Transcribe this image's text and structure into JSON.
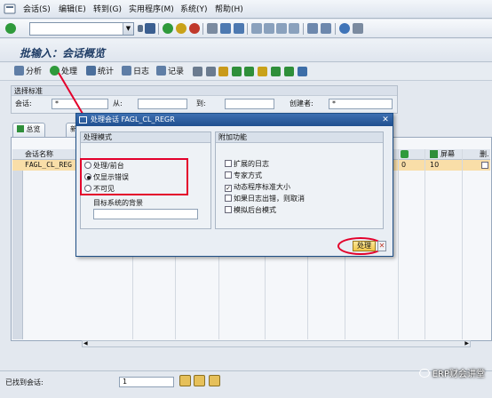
{
  "menubar": {
    "items": [
      {
        "label": "会话(S)"
      },
      {
        "label": "编辑(E)"
      },
      {
        "label": "转到(G)"
      },
      {
        "label": "实用程序(M)"
      },
      {
        "label": "系统(Y)"
      },
      {
        "label": "帮助(H)"
      }
    ]
  },
  "toolbar": {
    "command_field_value": ""
  },
  "page": {
    "title": "批输入：会话概览"
  },
  "app_toolbar": {
    "analyze_label": "分析",
    "process_label": "处理",
    "stats_label": "统计",
    "log_label": "日志",
    "record_label": "记录"
  },
  "selection": {
    "header": "选择标准",
    "session_label": "会话:",
    "session_value": "*",
    "from_label": "从:",
    "to_label": "到:",
    "creator_label": "创建者:",
    "creator_value": "*"
  },
  "tabs": [
    {
      "label": "总览"
    },
    {
      "label": "新"
    }
  ],
  "grid": {
    "col_name": "会话名称",
    "col_screens": "屏幕",
    "col_delete": "删.",
    "row": {
      "name": "FAGL_CL_REG",
      "count": "0",
      "screens": "10"
    }
  },
  "dialog": {
    "title": "处理会话 FAGL_CL_REGR",
    "mode_group": "处理模式",
    "modes": [
      {
        "label": "处理/前台",
        "selected": false
      },
      {
        "label": "仅显示错误",
        "selected": true
      },
      {
        "label": "不可见",
        "selected": false
      }
    ],
    "target_label": "目标系统的背景",
    "target_value": "",
    "extra_group": "附加功能",
    "options": [
      {
        "label": "扩展的日志",
        "checked": false
      },
      {
        "label": "专家方式",
        "checked": false
      },
      {
        "label": "动态程序标准大小",
        "checked": true
      },
      {
        "label": "如果日志出错，则取消",
        "checked": false
      },
      {
        "label": "模拟后台模式",
        "checked": false
      }
    ],
    "process_button": "处理",
    "cancel_button": "✕"
  },
  "status": {
    "found_label": "已找到会话:",
    "found_value": "1"
  },
  "watermark": {
    "text": "ERP财会讲堂"
  },
  "colors": {
    "accent": "#1f4f8f",
    "highlight": "#e3002b",
    "selected_row": "#f9dea8"
  }
}
